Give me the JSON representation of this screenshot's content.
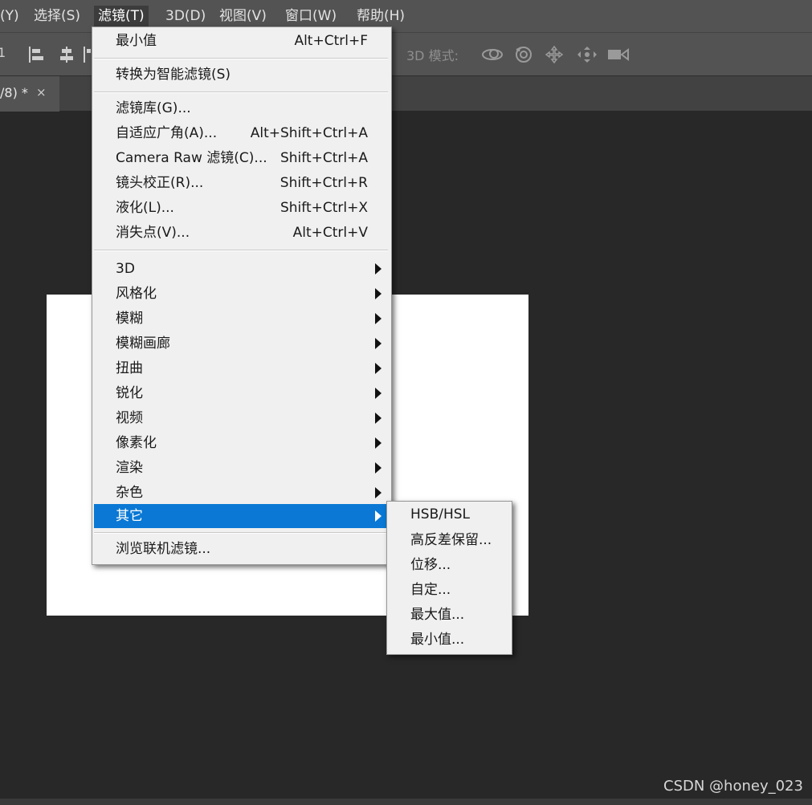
{
  "menubar": {
    "items": [
      {
        "label": "(Y)",
        "active": false
      },
      {
        "label": "选择(S)",
        "active": false
      },
      {
        "label": "滤镜(T)",
        "active": true
      },
      {
        "label": "3D(D)",
        "active": false
      },
      {
        "label": "视图(V)",
        "active": false
      },
      {
        "label": "窗口(W)",
        "active": false
      },
      {
        "label": "帮助(H)",
        "active": false
      }
    ]
  },
  "options_bar": {
    "first_glyph": "1",
    "mode_label": "3D 模式:",
    "icons": [
      "align-left-edges-icon",
      "align-horizontal-centers-icon",
      "3d-orbit-icon",
      "3d-roll-icon",
      "3d-pan-icon",
      "3d-slide-icon",
      "3d-video-camera-icon"
    ]
  },
  "document_tab": {
    "label": "/8) *",
    "close": "×"
  },
  "filter_menu": {
    "last_filter": {
      "label": "最小值",
      "shortcut": "Alt+Ctrl+F"
    },
    "convert_smart": {
      "label": "转换为智能滤镜(S)"
    },
    "items": [
      {
        "label": "滤镜库(G)...",
        "shortcut": ""
      },
      {
        "label": "自适应广角(A)...",
        "shortcut": "Alt+Shift+Ctrl+A"
      },
      {
        "label": "Camera Raw 滤镜(C)...",
        "shortcut": "Shift+Ctrl+A"
      },
      {
        "label": "镜头校正(R)...",
        "shortcut": "Shift+Ctrl+R"
      },
      {
        "label": "液化(L)...",
        "shortcut": "Shift+Ctrl+X"
      },
      {
        "label": "消失点(V)...",
        "shortcut": "Alt+Ctrl+V"
      }
    ],
    "submenus": [
      {
        "label": "3D"
      },
      {
        "label": "风格化"
      },
      {
        "label": "模糊"
      },
      {
        "label": "模糊画廊"
      },
      {
        "label": "扭曲"
      },
      {
        "label": "锐化"
      },
      {
        "label": "视频"
      },
      {
        "label": "像素化"
      },
      {
        "label": "渲染"
      },
      {
        "label": "杂色"
      },
      {
        "label": "其它",
        "highlighted": true
      }
    ],
    "browse": {
      "label": "浏览联机滤镜..."
    }
  },
  "other_submenu": {
    "items": [
      {
        "label": "HSB/HSL"
      },
      {
        "label": "高反差保留..."
      },
      {
        "label": "位移..."
      },
      {
        "label": "自定..."
      },
      {
        "label": "最大值..."
      },
      {
        "label": "最小值..."
      }
    ]
  },
  "watermark": "CSDN @honey_023",
  "colors": {
    "app_background": "#282828",
    "bar_background": "#535353",
    "menu_background": "#f0f0f0",
    "highlight": "#0a78d4",
    "canvas": "#ffffff"
  }
}
